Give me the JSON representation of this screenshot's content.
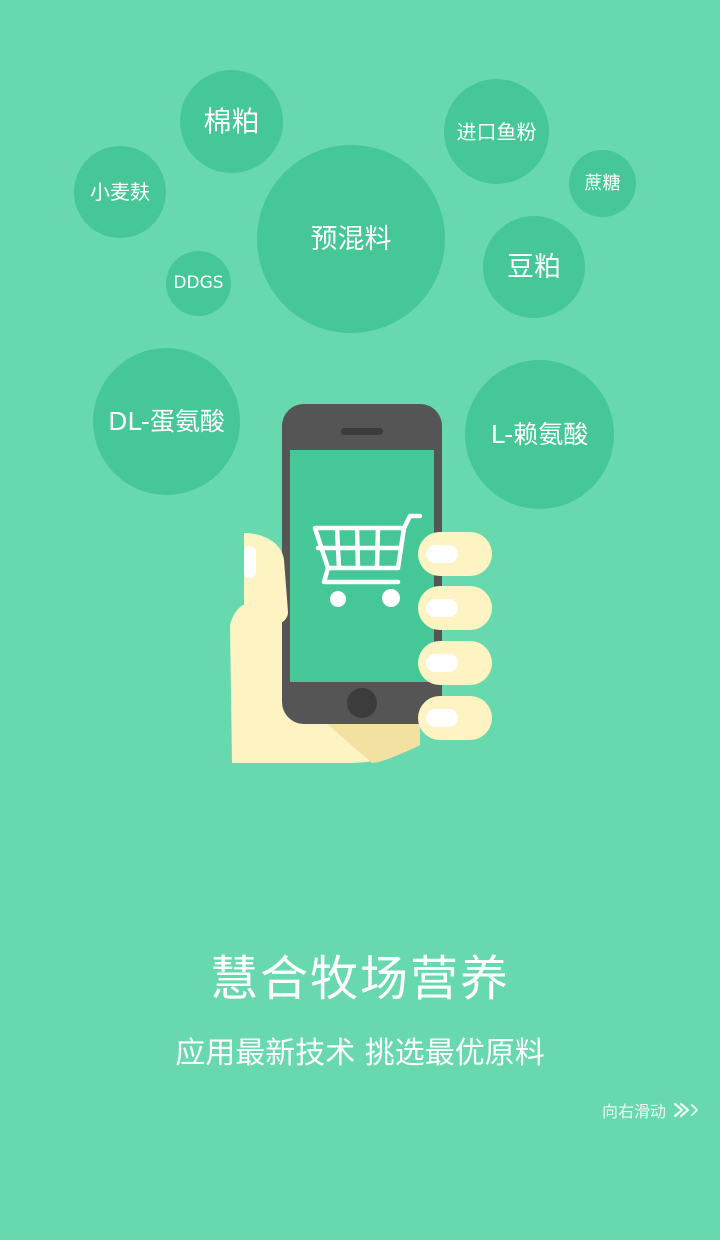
{
  "bubbles": {
    "cotton_meal": "棉粕",
    "wheat_bran": "小麦麸",
    "imported_fishmeal": "进口鱼粉",
    "cane_sugar": "蔗糖",
    "premix": "预混料",
    "soybean_meal": "豆粕",
    "ddgs": "DDGS",
    "dl_methionine": "DL-蛋氨酸",
    "l_lysine": "L-赖氨酸"
  },
  "headline": "慧合牧场营养",
  "subline": "应用最新技术 挑选最优原料",
  "swipe": {
    "label": "向右滑动",
    "icon": "double-chevron-right-icon"
  },
  "colors": {
    "background": "#68d9ae",
    "bubble": "#45c797",
    "phone_body": "#555555",
    "phone_screen": "#45c797",
    "hand": "#fdf3c3",
    "hand_shadow": "#f3e1a2"
  }
}
